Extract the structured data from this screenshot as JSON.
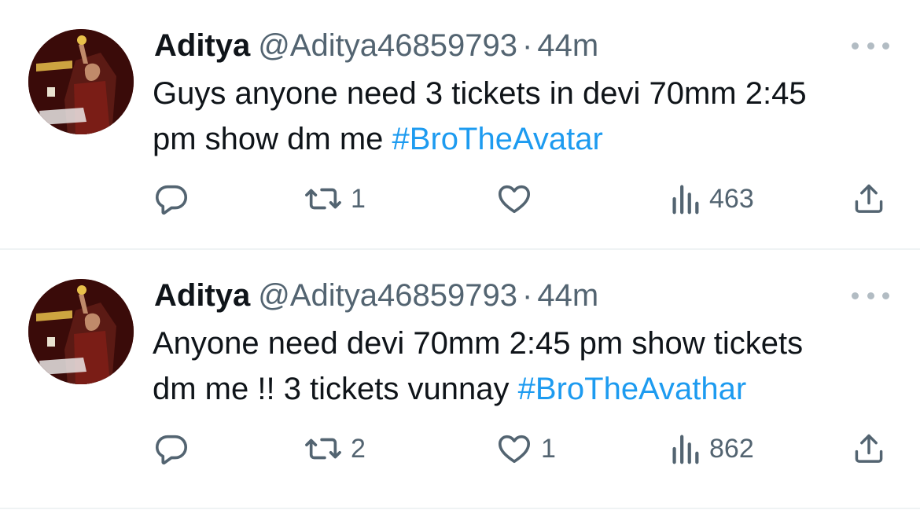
{
  "tweets": [
    {
      "author_name": "Aditya",
      "handle": "@Aditya46859793",
      "separator": "·",
      "time": "44m",
      "text_main": "Guys anyone need 3 tickets in devi 70mm 2:45",
      "text_line2": "pm show dm me ",
      "hashtag": "#BroTheAvatar",
      "replies": "",
      "retweets": "1",
      "likes": "",
      "views": "463"
    },
    {
      "author_name": "Aditya",
      "handle": "@Aditya46859793",
      "separator": "·",
      "time": "44m",
      "text_main": "Anyone need devi 70mm 2:45 pm show tickets",
      "text_line2": "dm me !! 3 tickets vunnay ",
      "hashtag": "#BroTheAvathar",
      "replies": "",
      "retweets": "2",
      "likes": "1",
      "views": "862"
    }
  ],
  "icons": {
    "reply": "reply-icon",
    "retweet": "retweet-icon",
    "like": "heart-icon",
    "views": "views-icon",
    "share": "share-icon",
    "more": "more-icon"
  },
  "colors": {
    "text": "#0f1419",
    "secondary": "#536471",
    "hashtag": "#1d9bf0",
    "divider": "#eff3f4"
  }
}
